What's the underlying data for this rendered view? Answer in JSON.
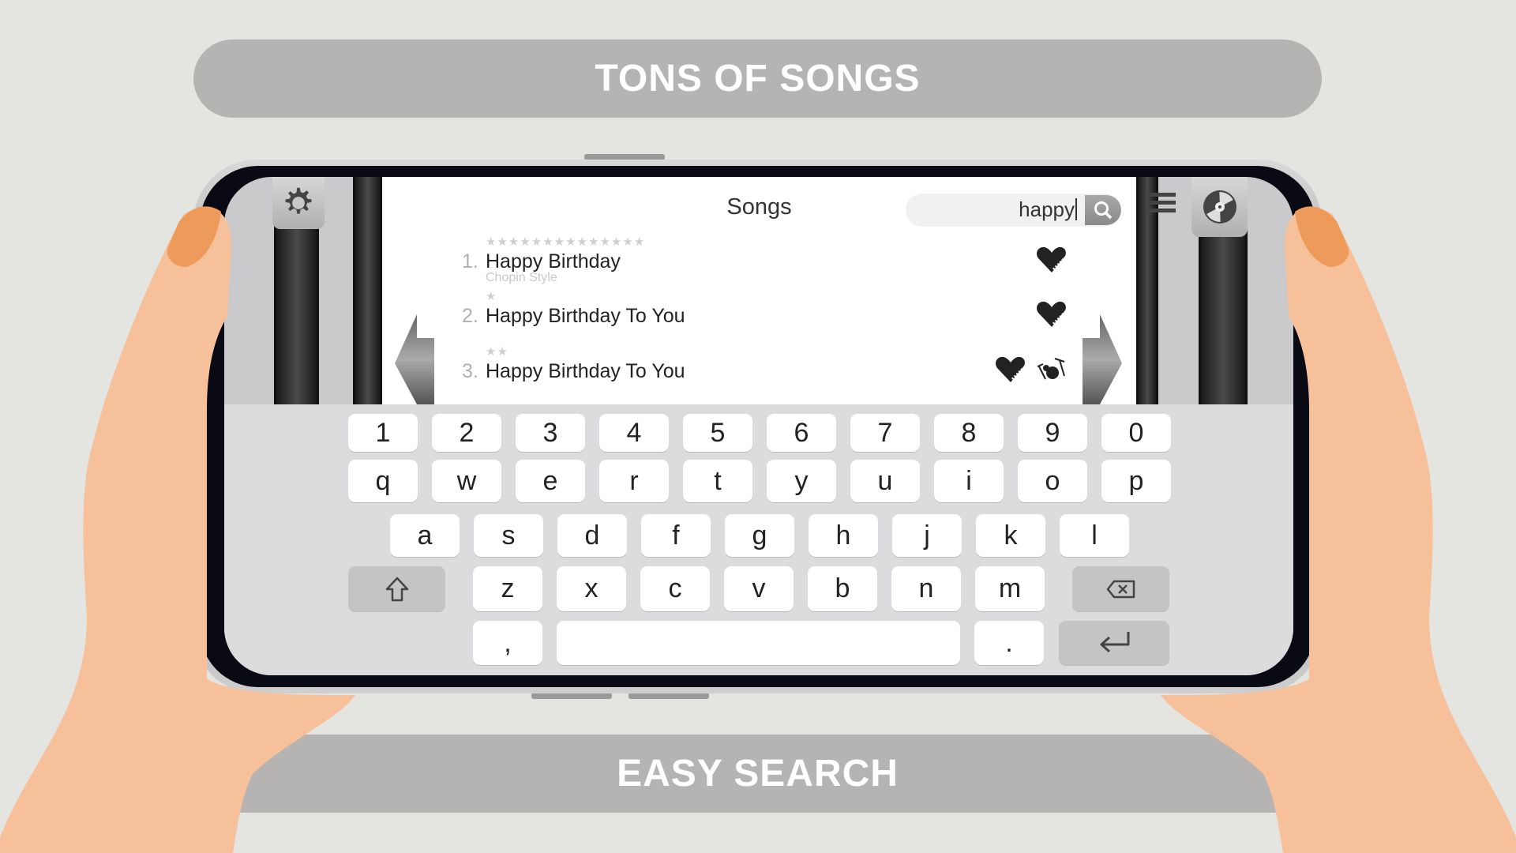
{
  "banners": {
    "top": "TONS OF SONGS",
    "bottom": "EASY SEARCH"
  },
  "app": {
    "title": "Songs",
    "search": {
      "value": "happy"
    },
    "icons": {
      "settings": "gear-icon",
      "menu": "hamburger-menu-icon",
      "records": "record-disc-icon",
      "search": "magnifier-icon",
      "prev": "arrow-left-icon",
      "next": "arrow-right-icon"
    },
    "songs": [
      {
        "number": "1.",
        "title": "Happy Birthday",
        "subtitle": "Chopin Style",
        "stars": "★★★★★★★★★★★★★★",
        "instruments": [
          "piano-heart-icon"
        ]
      },
      {
        "number": "2.",
        "title": "Happy Birthday To You",
        "subtitle": "",
        "stars": "★",
        "instruments": [
          "piano-heart-icon"
        ]
      },
      {
        "number": "3.",
        "title": "Happy Birthday To You",
        "subtitle": "",
        "stars": "★★",
        "instruments": [
          "piano-heart-icon",
          "drums-icon"
        ]
      }
    ]
  },
  "keyboard": {
    "row1": [
      "1",
      "2",
      "3",
      "4",
      "5",
      "6",
      "7",
      "8",
      "9",
      "0"
    ],
    "row2": [
      "q",
      "w",
      "e",
      "r",
      "t",
      "y",
      "u",
      "i",
      "o",
      "p"
    ],
    "row3": [
      "a",
      "s",
      "d",
      "f",
      "g",
      "h",
      "j",
      "k",
      "l"
    ],
    "row4": [
      "z",
      "x",
      "c",
      "v",
      "b",
      "n",
      "m"
    ],
    "comma": ",",
    "period": ".",
    "shift_icon": "shift-arrow-icon",
    "backspace_icon": "backspace-icon",
    "enter_icon": "enter-icon"
  },
  "colors": {
    "skin": "#f6c09a",
    "nail": "#ee9a5a",
    "banner": "#b5b4b2",
    "background": "#e4e4e1"
  }
}
